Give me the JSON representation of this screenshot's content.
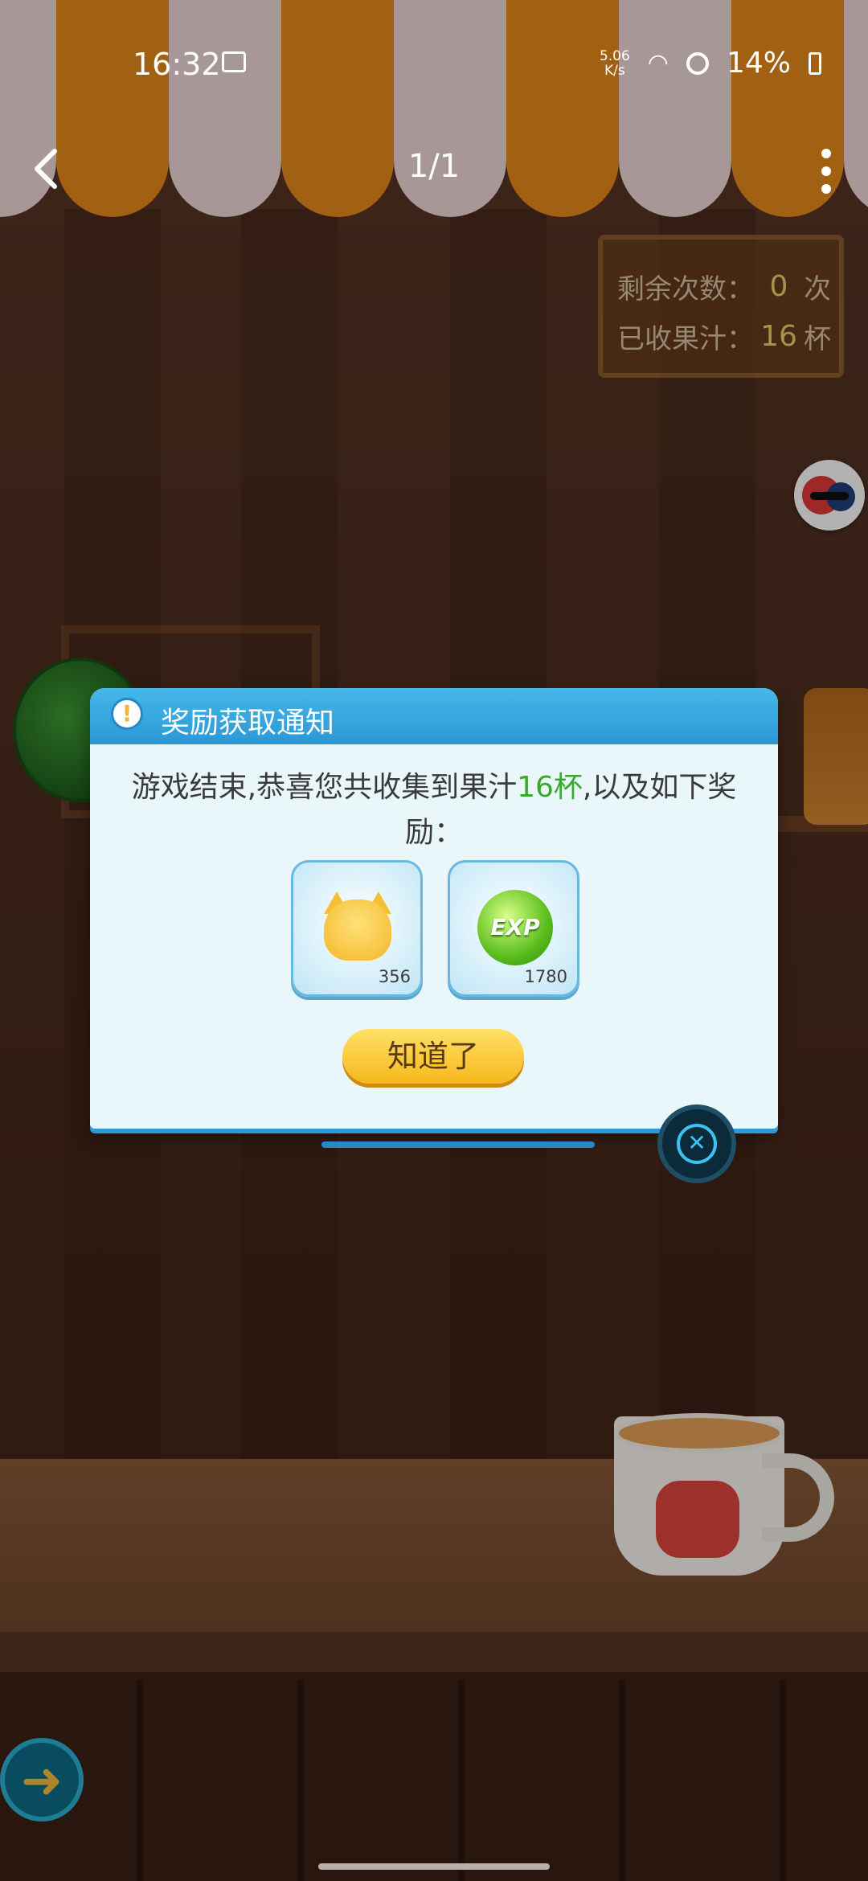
{
  "status_bar": {
    "time": "16:32",
    "net_speed_value": "5.06",
    "net_speed_unit": "K/s",
    "battery": "14%"
  },
  "top_bar": {
    "page_indicator": "1/1"
  },
  "sign": {
    "remaining_label": "剩余次数：",
    "remaining_value": "0",
    "remaining_unit": "次",
    "collected_label": "已收果汁：",
    "collected_value": "16",
    "collected_unit": "杯"
  },
  "dialog": {
    "title": "奖励获取通知",
    "message_pre": "游戏结束,恭喜您共收集到果汁",
    "message_highlight": "16杯",
    "message_post": ",以及如下奖励：",
    "rewards": [
      {
        "icon": "cat-coin-icon",
        "amount": "356"
      },
      {
        "icon": "exp-orb-icon",
        "amount": "1780",
        "label": "EXP"
      }
    ],
    "ok_label": "知道了"
  },
  "colors": {
    "dialog_header": "#2a98d6",
    "highlight": "#3aa82d",
    "ok_button": "#f6b81c"
  }
}
